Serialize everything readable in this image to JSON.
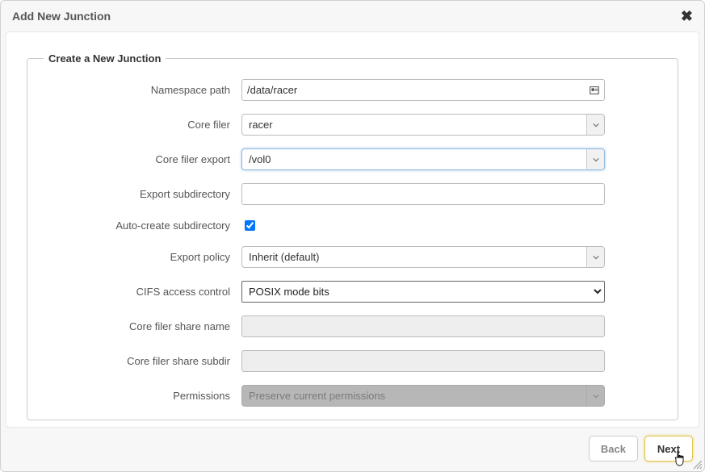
{
  "dialog": {
    "title": "Add New Junction"
  },
  "legend": "Create a New Junction",
  "labels": {
    "namespace_path": "Namespace path",
    "core_filer": "Core filer",
    "core_filer_export": "Core filer export",
    "export_subdir": "Export subdirectory",
    "auto_create": "Auto-create subdirectory",
    "export_policy": "Export policy",
    "cifs_access": "CIFS access control",
    "share_name": "Core filer share name",
    "share_subdir": "Core filer share subdir",
    "permissions": "Permissions"
  },
  "values": {
    "namespace_path": "/data/racer",
    "core_filer": "racer",
    "core_filer_export": "/vol0",
    "export_subdir": "",
    "auto_create_checked": true,
    "export_policy": "Inherit (default)",
    "cifs_access": "POSIX mode bits",
    "share_name": "",
    "share_subdir": "",
    "permissions": "Preserve current permissions"
  },
  "buttons": {
    "back": "Back",
    "next": "Next"
  }
}
